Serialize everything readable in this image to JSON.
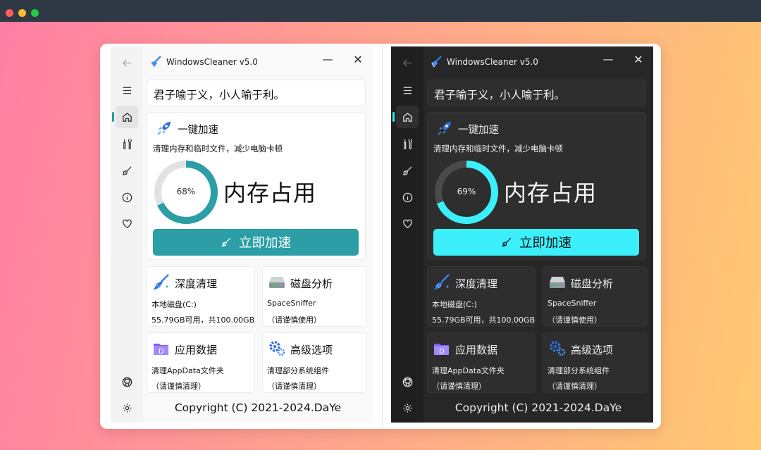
{
  "colors": {
    "light_accent": "#2b9ea6",
    "dark_accent": "#3bf0fb",
    "light_track": "#e2e2e2",
    "dark_track": "#4a4a4a"
  },
  "light": {
    "app_title": "WindowsCleaner v5.0",
    "controls": {
      "minimize": "—",
      "close": "✕"
    },
    "quote": "君子喻于义，小人喻于利。",
    "speed": {
      "title": "一键加速",
      "desc": "清理内存和临时文件，减少电脑卡顿",
      "memory_percent_text": "68%",
      "memory_percent_value": 68,
      "memory_label": "内存占用",
      "button_label": "立即加速"
    },
    "tiles": [
      {
        "title": "深度清理",
        "line1": "本地磁盘(C:)",
        "line2": "55.79GB可用，共100.00GB",
        "icon": "broom-icon"
      },
      {
        "title": "磁盘分析",
        "line1": "SpaceSniffer",
        "line2": "（请谨慎使用）",
        "icon": "disk-icon"
      },
      {
        "title": "应用数据",
        "line1": "清理AppData文件夹",
        "line2": "（请谨慎清理）",
        "icon": "folder-icon"
      },
      {
        "title": "高级选项",
        "line1": "清理部分系统组件",
        "line2": "（请谨慎清理）",
        "icon": "gears-icon"
      }
    ],
    "copyright": "Copyright (C) 2021-2024.DaYe"
  },
  "dark": {
    "app_title": "WindowsCleaner v5.0",
    "controls": {
      "minimize": "—",
      "close": "✕"
    },
    "quote": "君子喻于义，小人喻于利。",
    "speed": {
      "title": "一键加速",
      "desc": "清理内存和临时文件，减少电脑卡顿",
      "memory_percent_text": "69%",
      "memory_percent_value": 69,
      "memory_label": "内存占用",
      "button_label": "立即加速"
    },
    "tiles": [
      {
        "title": "深度清理",
        "line1": "本地磁盘(C:)",
        "line2": "55.79GB可用，共100.00GB",
        "icon": "broom-icon"
      },
      {
        "title": "磁盘分析",
        "line1": "SpaceSniffer",
        "line2": "（请谨慎使用）",
        "icon": "disk-icon"
      },
      {
        "title": "应用数据",
        "line1": "清理AppData文件夹",
        "line2": "（请谨慎清理）",
        "icon": "folder-icon"
      },
      {
        "title": "高级选项",
        "line1": "清理部分系统组件",
        "line2": "（请谨慎清理）",
        "icon": "gears-icon"
      }
    ],
    "copyright": "Copyright (C) 2021-2024.DaYe"
  },
  "sidebar_icons": [
    "back-arrow-icon",
    "menu-icon",
    "home-icon",
    "tools-icon",
    "broom-icon",
    "info-icon",
    "heart-icon",
    "github-icon",
    "settings-icon"
  ]
}
